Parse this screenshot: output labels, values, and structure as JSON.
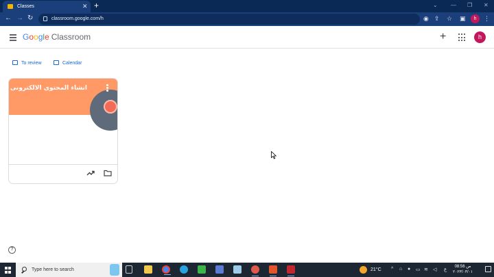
{
  "browser": {
    "tab_title": "Classes",
    "url": "classroom.google.com/h"
  },
  "app": {
    "logo_google": [
      "G",
      "o",
      "o",
      "g",
      "l",
      "e"
    ],
    "logo_product": "Classroom",
    "avatar_initial": "h"
  },
  "quick_links": {
    "to_review": "To review",
    "calendar": "Calendar"
  },
  "class_card": {
    "title": "انشاء المحتوى الالكترونى",
    "header_color": "#ff9966"
  },
  "taskbar": {
    "search_placeholder": "Type here to search",
    "temperature": "21°C",
    "language": "ع",
    "time": "08:56 ص",
    "date": "٢٠٢٣/٠٣/٠١"
  },
  "colors": {
    "chrome_frame": "#0a2a55",
    "accent": "#1967d2",
    "avatar": "#c2185b"
  },
  "icons": [
    "menu-icon",
    "plus-icon",
    "apps-icon",
    "trending-icon",
    "folder-icon",
    "help-icon",
    "search-icon",
    "windows-icon"
  ]
}
